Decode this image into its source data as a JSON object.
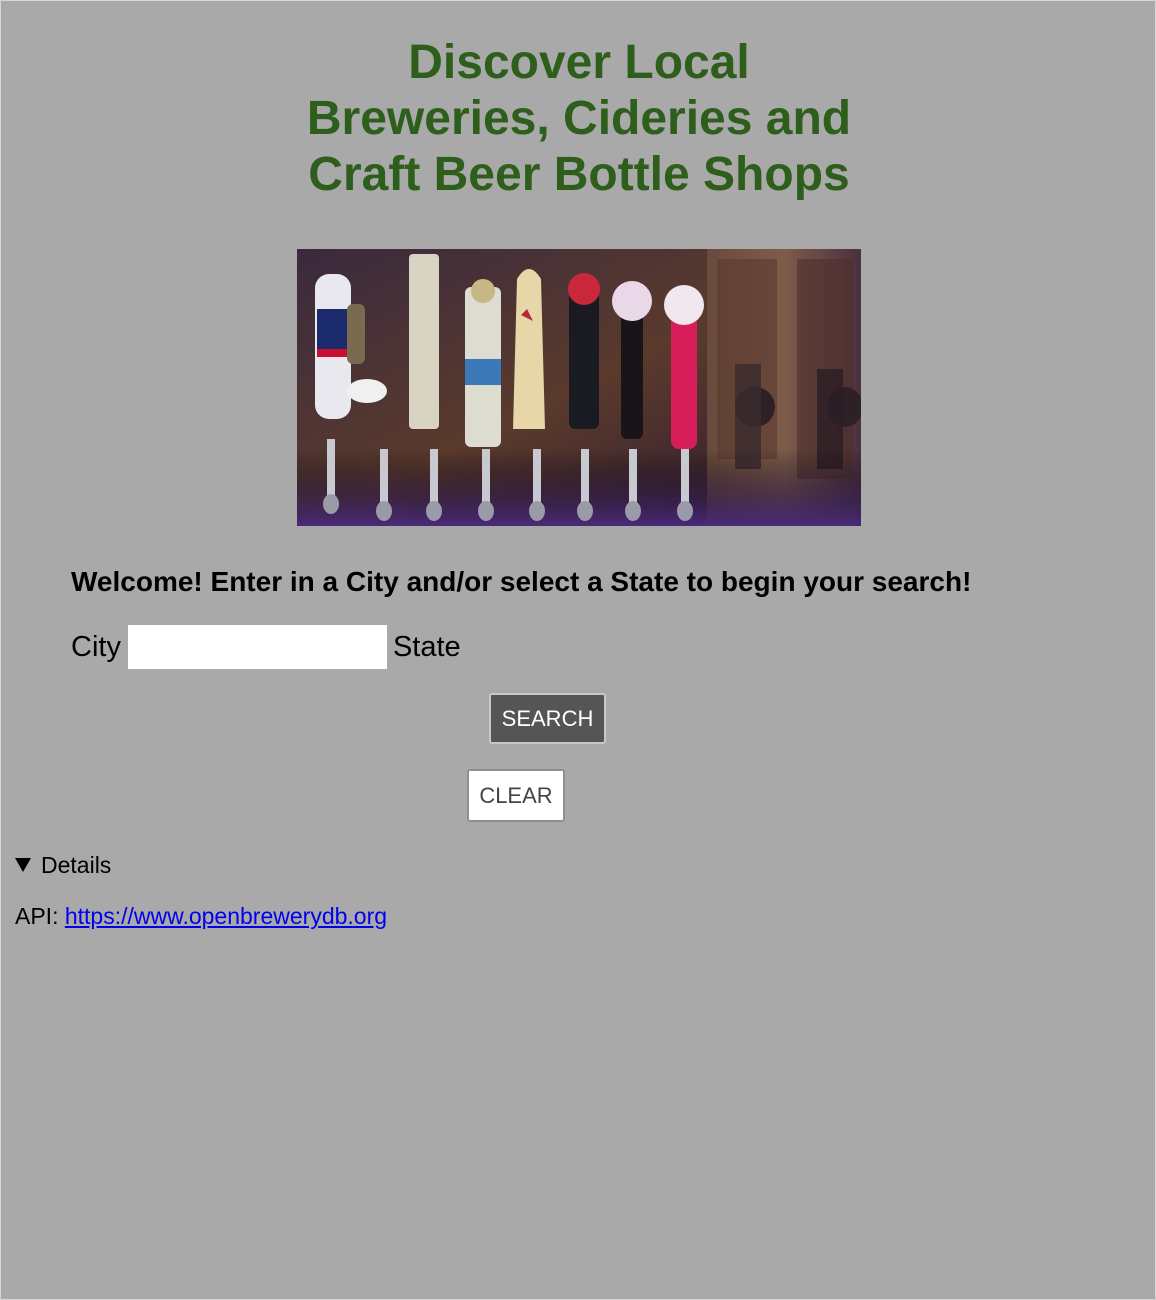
{
  "header": {
    "title_line1": "Discover Local",
    "title_line2": "Breweries, Cideries and",
    "title_line3": "Craft Beer Bottle Shops"
  },
  "hero": {
    "image_description_name": "beer-taps-image"
  },
  "search": {
    "welcome_text": "Welcome! Enter in a City and/or select a State to begin your search!",
    "city_label": "City",
    "city_value": "",
    "state_label": "State",
    "search_button_label": "SEARCH",
    "clear_button_label": "CLEAR"
  },
  "details": {
    "summary_label": "Details",
    "api_label": "API:",
    "api_link_text": "https://www.openbrewerydb.org"
  },
  "colors": {
    "background": "#a9a9a9",
    "title": "#2e5e1b",
    "search_button_bg": "#555555",
    "clear_button_bg": "#ffffff",
    "link": "#0000ee"
  }
}
